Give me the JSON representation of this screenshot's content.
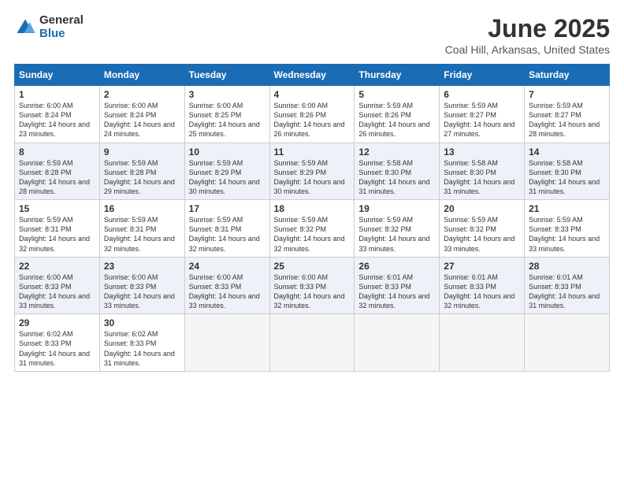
{
  "logo": {
    "general": "General",
    "blue": "Blue"
  },
  "title": "June 2025",
  "location": "Coal Hill, Arkansas, United States",
  "weekdays": [
    "Sunday",
    "Monday",
    "Tuesday",
    "Wednesday",
    "Thursday",
    "Friday",
    "Saturday"
  ],
  "weeks": [
    [
      {
        "day": "1",
        "sunrise": "6:00 AM",
        "sunset": "8:24 PM",
        "daylight": "14 hours and 23 minutes."
      },
      {
        "day": "2",
        "sunrise": "6:00 AM",
        "sunset": "8:24 PM",
        "daylight": "14 hours and 24 minutes."
      },
      {
        "day": "3",
        "sunrise": "6:00 AM",
        "sunset": "8:25 PM",
        "daylight": "14 hours and 25 minutes."
      },
      {
        "day": "4",
        "sunrise": "6:00 AM",
        "sunset": "8:26 PM",
        "daylight": "14 hours and 26 minutes."
      },
      {
        "day": "5",
        "sunrise": "5:59 AM",
        "sunset": "8:26 PM",
        "daylight": "14 hours and 26 minutes."
      },
      {
        "day": "6",
        "sunrise": "5:59 AM",
        "sunset": "8:27 PM",
        "daylight": "14 hours and 27 minutes."
      },
      {
        "day": "7",
        "sunrise": "5:59 AM",
        "sunset": "8:27 PM",
        "daylight": "14 hours and 28 minutes."
      }
    ],
    [
      {
        "day": "8",
        "sunrise": "5:59 AM",
        "sunset": "8:28 PM",
        "daylight": "14 hours and 28 minutes."
      },
      {
        "day": "9",
        "sunrise": "5:59 AM",
        "sunset": "8:28 PM",
        "daylight": "14 hours and 29 minutes."
      },
      {
        "day": "10",
        "sunrise": "5:59 AM",
        "sunset": "8:29 PM",
        "daylight": "14 hours and 30 minutes."
      },
      {
        "day": "11",
        "sunrise": "5:59 AM",
        "sunset": "8:29 PM",
        "daylight": "14 hours and 30 minutes."
      },
      {
        "day": "12",
        "sunrise": "5:58 AM",
        "sunset": "8:30 PM",
        "daylight": "14 hours and 31 minutes."
      },
      {
        "day": "13",
        "sunrise": "5:58 AM",
        "sunset": "8:30 PM",
        "daylight": "14 hours and 31 minutes."
      },
      {
        "day": "14",
        "sunrise": "5:58 AM",
        "sunset": "8:30 PM",
        "daylight": "14 hours and 31 minutes."
      }
    ],
    [
      {
        "day": "15",
        "sunrise": "5:59 AM",
        "sunset": "8:31 PM",
        "daylight": "14 hours and 32 minutes."
      },
      {
        "day": "16",
        "sunrise": "5:59 AM",
        "sunset": "8:31 PM",
        "daylight": "14 hours and 32 minutes."
      },
      {
        "day": "17",
        "sunrise": "5:59 AM",
        "sunset": "8:31 PM",
        "daylight": "14 hours and 32 minutes."
      },
      {
        "day": "18",
        "sunrise": "5:59 AM",
        "sunset": "8:32 PM",
        "daylight": "14 hours and 32 minutes."
      },
      {
        "day": "19",
        "sunrise": "5:59 AM",
        "sunset": "8:32 PM",
        "daylight": "14 hours and 33 minutes."
      },
      {
        "day": "20",
        "sunrise": "5:59 AM",
        "sunset": "8:32 PM",
        "daylight": "14 hours and 33 minutes."
      },
      {
        "day": "21",
        "sunrise": "5:59 AM",
        "sunset": "8:33 PM",
        "daylight": "14 hours and 33 minutes."
      }
    ],
    [
      {
        "day": "22",
        "sunrise": "6:00 AM",
        "sunset": "8:33 PM",
        "daylight": "14 hours and 33 minutes."
      },
      {
        "day": "23",
        "sunrise": "6:00 AM",
        "sunset": "8:33 PM",
        "daylight": "14 hours and 33 minutes."
      },
      {
        "day": "24",
        "sunrise": "6:00 AM",
        "sunset": "8:33 PM",
        "daylight": "14 hours and 33 minutes."
      },
      {
        "day": "25",
        "sunrise": "6:00 AM",
        "sunset": "8:33 PM",
        "daylight": "14 hours and 32 minutes."
      },
      {
        "day": "26",
        "sunrise": "6:01 AM",
        "sunset": "8:33 PM",
        "daylight": "14 hours and 32 minutes."
      },
      {
        "day": "27",
        "sunrise": "6:01 AM",
        "sunset": "8:33 PM",
        "daylight": "14 hours and 32 minutes."
      },
      {
        "day": "28",
        "sunrise": "6:01 AM",
        "sunset": "8:33 PM",
        "daylight": "14 hours and 31 minutes."
      }
    ],
    [
      {
        "day": "29",
        "sunrise": "6:02 AM",
        "sunset": "8:33 PM",
        "daylight": "14 hours and 31 minutes."
      },
      {
        "day": "30",
        "sunrise": "6:02 AM",
        "sunset": "8:33 PM",
        "daylight": "14 hours and 31 minutes."
      },
      null,
      null,
      null,
      null,
      null
    ]
  ]
}
